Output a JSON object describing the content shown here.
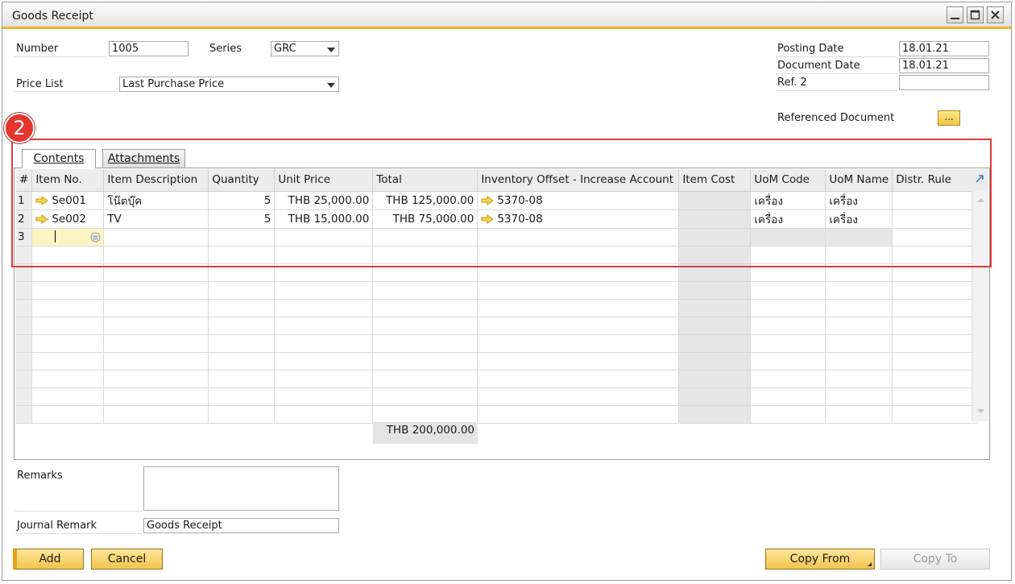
{
  "window": {
    "title": "Goods Receipt"
  },
  "header": {
    "number_label": "Number",
    "number_value": "1005",
    "series_label": "Series",
    "series_value": "GRC",
    "price_list_label": "Price List",
    "price_list_value": "Last Purchase Price",
    "posting_date_label": "Posting Date",
    "posting_date_value": "18.01.21",
    "document_date_label": "Document Date",
    "document_date_value": "18.01.21",
    "ref2_label": "Ref. 2",
    "ref2_value": "",
    "referenced_document_label": "Referenced Document",
    "referenced_document_button": "..."
  },
  "callout": {
    "number": "2"
  },
  "tabs": [
    {
      "label": "Contents",
      "active": true
    },
    {
      "label": "Attachments",
      "active": false
    }
  ],
  "grid": {
    "columns": [
      "#",
      "Item No.",
      "Item Description",
      "Quantity",
      "Unit Price",
      "Total",
      "Inventory Offset - Increase Account",
      "Item Cost",
      "UoM Code",
      "UoM Name",
      "Distr. Rule"
    ],
    "rows": [
      {
        "num": "1",
        "item_no": "Se001",
        "description": "โน๊ตบุ๊ค",
        "quantity": "5",
        "unit_price": "THB 25,000.00",
        "total": "THB 125,000.00",
        "account": "5370-08",
        "item_cost": "",
        "uom_code": "เครื่อง",
        "uom_name": "เครื่อง",
        "distr_rule": ""
      },
      {
        "num": "2",
        "item_no": "Se002",
        "description": "TV",
        "quantity": "5",
        "unit_price": "THB 15,000.00",
        "total": "THB 75,000.00",
        "account": "5370-08",
        "item_cost": "",
        "uom_code": "เครื่อง",
        "uom_name": "เครื่อง",
        "distr_rule": ""
      },
      {
        "num": "3",
        "item_no": "",
        "description": "",
        "quantity": "",
        "unit_price": "",
        "total": "",
        "account": "",
        "item_cost": "",
        "uom_code": "",
        "uom_name": "",
        "distr_rule": ""
      }
    ],
    "footer_total": "THB 200,000.00"
  },
  "footer": {
    "remarks_label": "Remarks",
    "remarks_value": "",
    "journal_remark_label": "Journal Remark",
    "journal_remark_value": "Goods Receipt"
  },
  "buttons": {
    "add": "Add",
    "cancel": "Cancel",
    "copy_from": "Copy From",
    "copy_to": "Copy To"
  },
  "colors": {
    "accent": "#f0b429",
    "highlight": "#e03b3b",
    "badge": "#e8352f",
    "active_cell": "#fdf4c4"
  }
}
